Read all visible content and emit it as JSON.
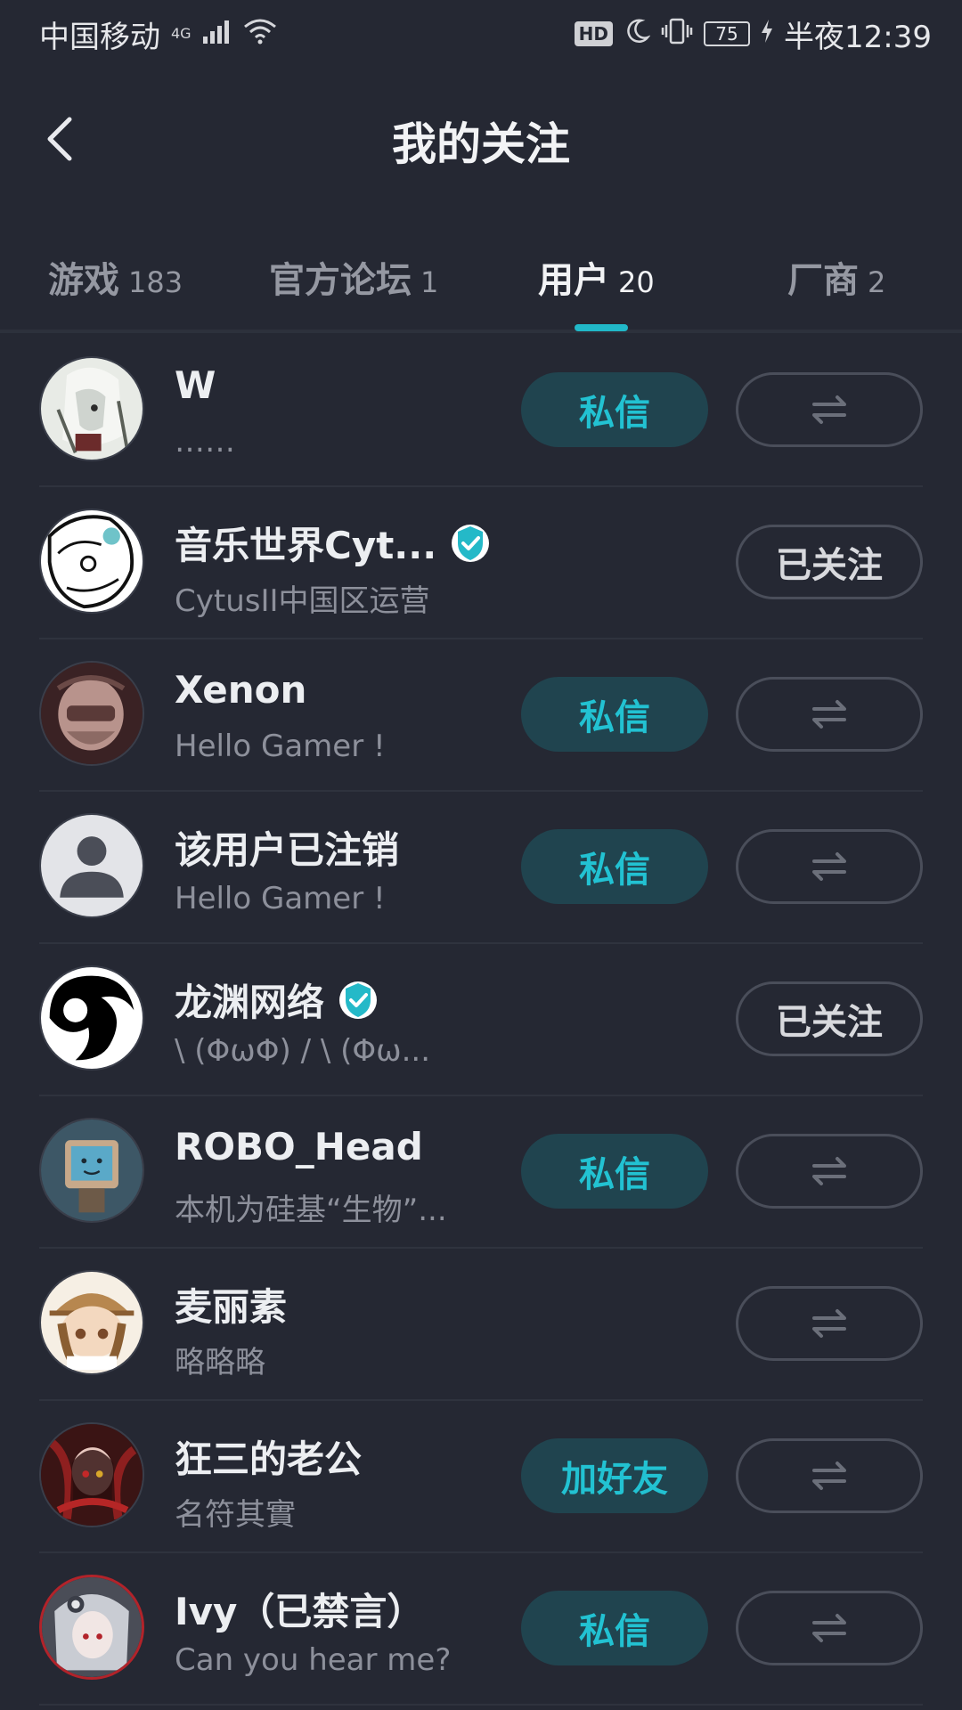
{
  "status_bar": {
    "carrier": "中国移动",
    "network": "4G",
    "hd": "HD",
    "battery": "75",
    "time": "半夜12:39"
  },
  "header": {
    "title": "我的关注"
  },
  "tabs": [
    {
      "label": "游戏",
      "count": "183"
    },
    {
      "label": "官方论坛",
      "count": "1"
    },
    {
      "label": "用户",
      "count": "20"
    },
    {
      "label": "厂商",
      "count": "2"
    }
  ],
  "users": [
    {
      "name": "W",
      "bio": "……",
      "primary_action": "私信",
      "secondary_action": "swap-icon"
    },
    {
      "name": "音乐世界Cyt...",
      "bio": "CytusII中国区运营",
      "secondary_action": "已关注"
    },
    {
      "name": "Xenon",
      "bio": "Hello Gamer !",
      "primary_action": "私信",
      "secondary_action": "swap-icon"
    },
    {
      "name": "该用户已注销",
      "bio": "Hello Gamer !",
      "primary_action": "私信",
      "secondary_action": "swap-icon"
    },
    {
      "name": "龙渊网络",
      "bio": "\\ (ΦωΦ) / \\ (Φω...",
      "secondary_action": "已关注"
    },
    {
      "name": "ROBO_Head",
      "bio": "本机为硅基“生物”...",
      "primary_action": "私信",
      "secondary_action": "swap-icon"
    },
    {
      "name": "麦丽素",
      "bio": "略略略",
      "secondary_action": "swap-icon"
    },
    {
      "name": "狂三的老公",
      "bio": "名符其實",
      "primary_action": "加好友",
      "secondary_action": "swap-icon"
    },
    {
      "name": "Ivy（已禁言）",
      "bio": "Can you hear me?",
      "primary_action": "私信",
      "secondary_action": "swap-icon"
    }
  ],
  "colors": {
    "background": "#252833",
    "accent": "#21b8c8",
    "primary_button_bg": "#20444f"
  }
}
